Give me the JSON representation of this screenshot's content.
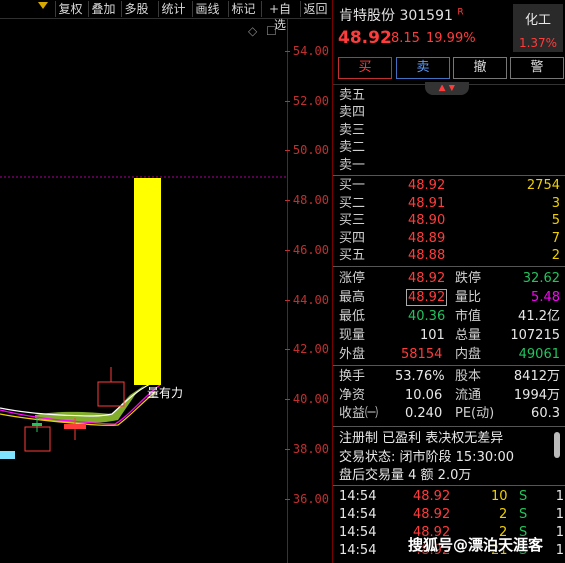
{
  "toolbar": {
    "buttons": [
      "复权",
      "叠加",
      "多股",
      "统计",
      "画线",
      "标记",
      "+自选",
      "返回"
    ]
  },
  "chart": {
    "y_ticks": [
      "54.00",
      "52.00",
      "50.00",
      "48.00",
      "46.00",
      "44.00",
      "42.00",
      "40.00",
      "38.00",
      "36.00"
    ],
    "annotation": "量有力",
    "corner_icons": [
      "◇",
      "☐"
    ]
  },
  "stock": {
    "name": "肯特股份",
    "code": "301591",
    "tag": "R",
    "price": "48.92",
    "change": "8.15",
    "change_pct": "19.99%",
    "sector": "化工",
    "sector_pct": "1.37%"
  },
  "trade_buttons": [
    "买",
    "卖",
    "撤",
    "警"
  ],
  "sell_orders": [
    {
      "label": "卖五"
    },
    {
      "label": "卖四"
    },
    {
      "label": "卖三"
    },
    {
      "label": "卖二"
    },
    {
      "label": "卖一"
    }
  ],
  "buy_orders": [
    {
      "label": "买一",
      "price": "48.92",
      "vol": "2754"
    },
    {
      "label": "买二",
      "price": "48.91",
      "vol": "3"
    },
    {
      "label": "买三",
      "price": "48.90",
      "vol": "5"
    },
    {
      "label": "买四",
      "price": "48.89",
      "vol": "7"
    },
    {
      "label": "买五",
      "price": "48.88",
      "vol": "2"
    }
  ],
  "stats_a": [
    {
      "l1": "涨停",
      "v1": "48.92",
      "l2": "跌停",
      "v2": "32.62"
    },
    {
      "l1": "最高",
      "v1": "48.92",
      "l2": "量比",
      "v2": "5.48"
    },
    {
      "l1": "最低",
      "v1": "40.36",
      "l2": "市值",
      "v2": "41.2亿"
    },
    {
      "l1": "现量",
      "v1": "101",
      "l2": "总量",
      "v2": "107215"
    },
    {
      "l1": "外盘",
      "v1": "58154",
      "l2": "内盘",
      "v2": "49061"
    }
  ],
  "stats_b": [
    {
      "l1": "换手",
      "v1": "53.76%",
      "l2": "股本",
      "v2": "8412万"
    },
    {
      "l1": "净资",
      "v1": "10.06",
      "l2": "流通",
      "v2": "1994万"
    },
    {
      "l1": "收益㈠",
      "v1": "0.240",
      "l2": "PE(动)",
      "v2": "60.3"
    }
  ],
  "info": {
    "line1": "注册制 已盈利 表决权无差异",
    "line2": "交易状态: 闭市阶段 15:30:00",
    "line3": "盘后交易量 4 额 2.0万"
  },
  "ticks": [
    {
      "time": "14:54",
      "price": "48.92",
      "vol": "10",
      "side": "S",
      "n": "1"
    },
    {
      "time": "14:54",
      "price": "48.92",
      "vol": "2",
      "side": "S",
      "n": "1"
    },
    {
      "time": "14:54",
      "price": "48.92",
      "vol": "2",
      "side": "S",
      "n": "1"
    },
    {
      "time": "14:54",
      "price": "48.92",
      "vol": "21",
      "side": "S",
      "n": "1"
    }
  ],
  "watermark": "搜狐号@漂泊天涯客",
  "colors": {
    "up": "#ff3c3c",
    "down": "#22c35e",
    "limit_bar": "#ffff00",
    "accent": "#d6a800"
  }
}
